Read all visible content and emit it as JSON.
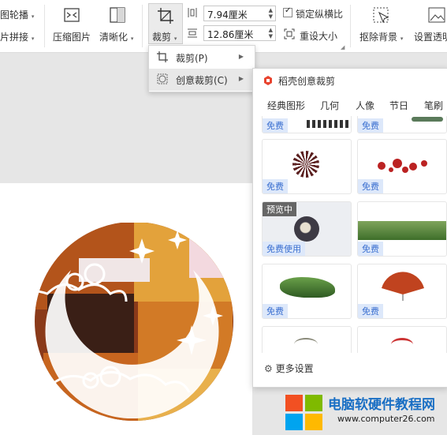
{
  "ribbon": {
    "outline_label": "图轮播",
    "merge_label": "片拼接",
    "compress_label": "压缩图片",
    "clarity_label": "清晰化",
    "crop_label": "裁剪",
    "width_value": "7.94厘米",
    "height_value": "12.86厘米",
    "lock_ratio_label": "锁定纵横比",
    "reset_size_label": "重设大小",
    "remove_bg_label": "抠除背景",
    "set_transparent_label": "设置透明"
  },
  "crop_menu": {
    "items": [
      {
        "label": "裁剪(P)"
      },
      {
        "label": "创意裁剪(C)"
      }
    ]
  },
  "creative_panel": {
    "title": "稻壳创意裁剪",
    "categories": [
      "经典图形",
      "几何",
      "人像",
      "节日",
      "笔刷"
    ],
    "free_label": "免费",
    "free_use_label": "免费使用",
    "preview_label": "预览中",
    "more_settings_label": "更多设置"
  },
  "watermark": {
    "title": "电脑软硬件教程网",
    "url": "www.computer26.com"
  },
  "colors": {
    "accent_blue": "#3a6fd0",
    "badge_bg": "#dde8fa",
    "logo_red": "#e8432e"
  }
}
